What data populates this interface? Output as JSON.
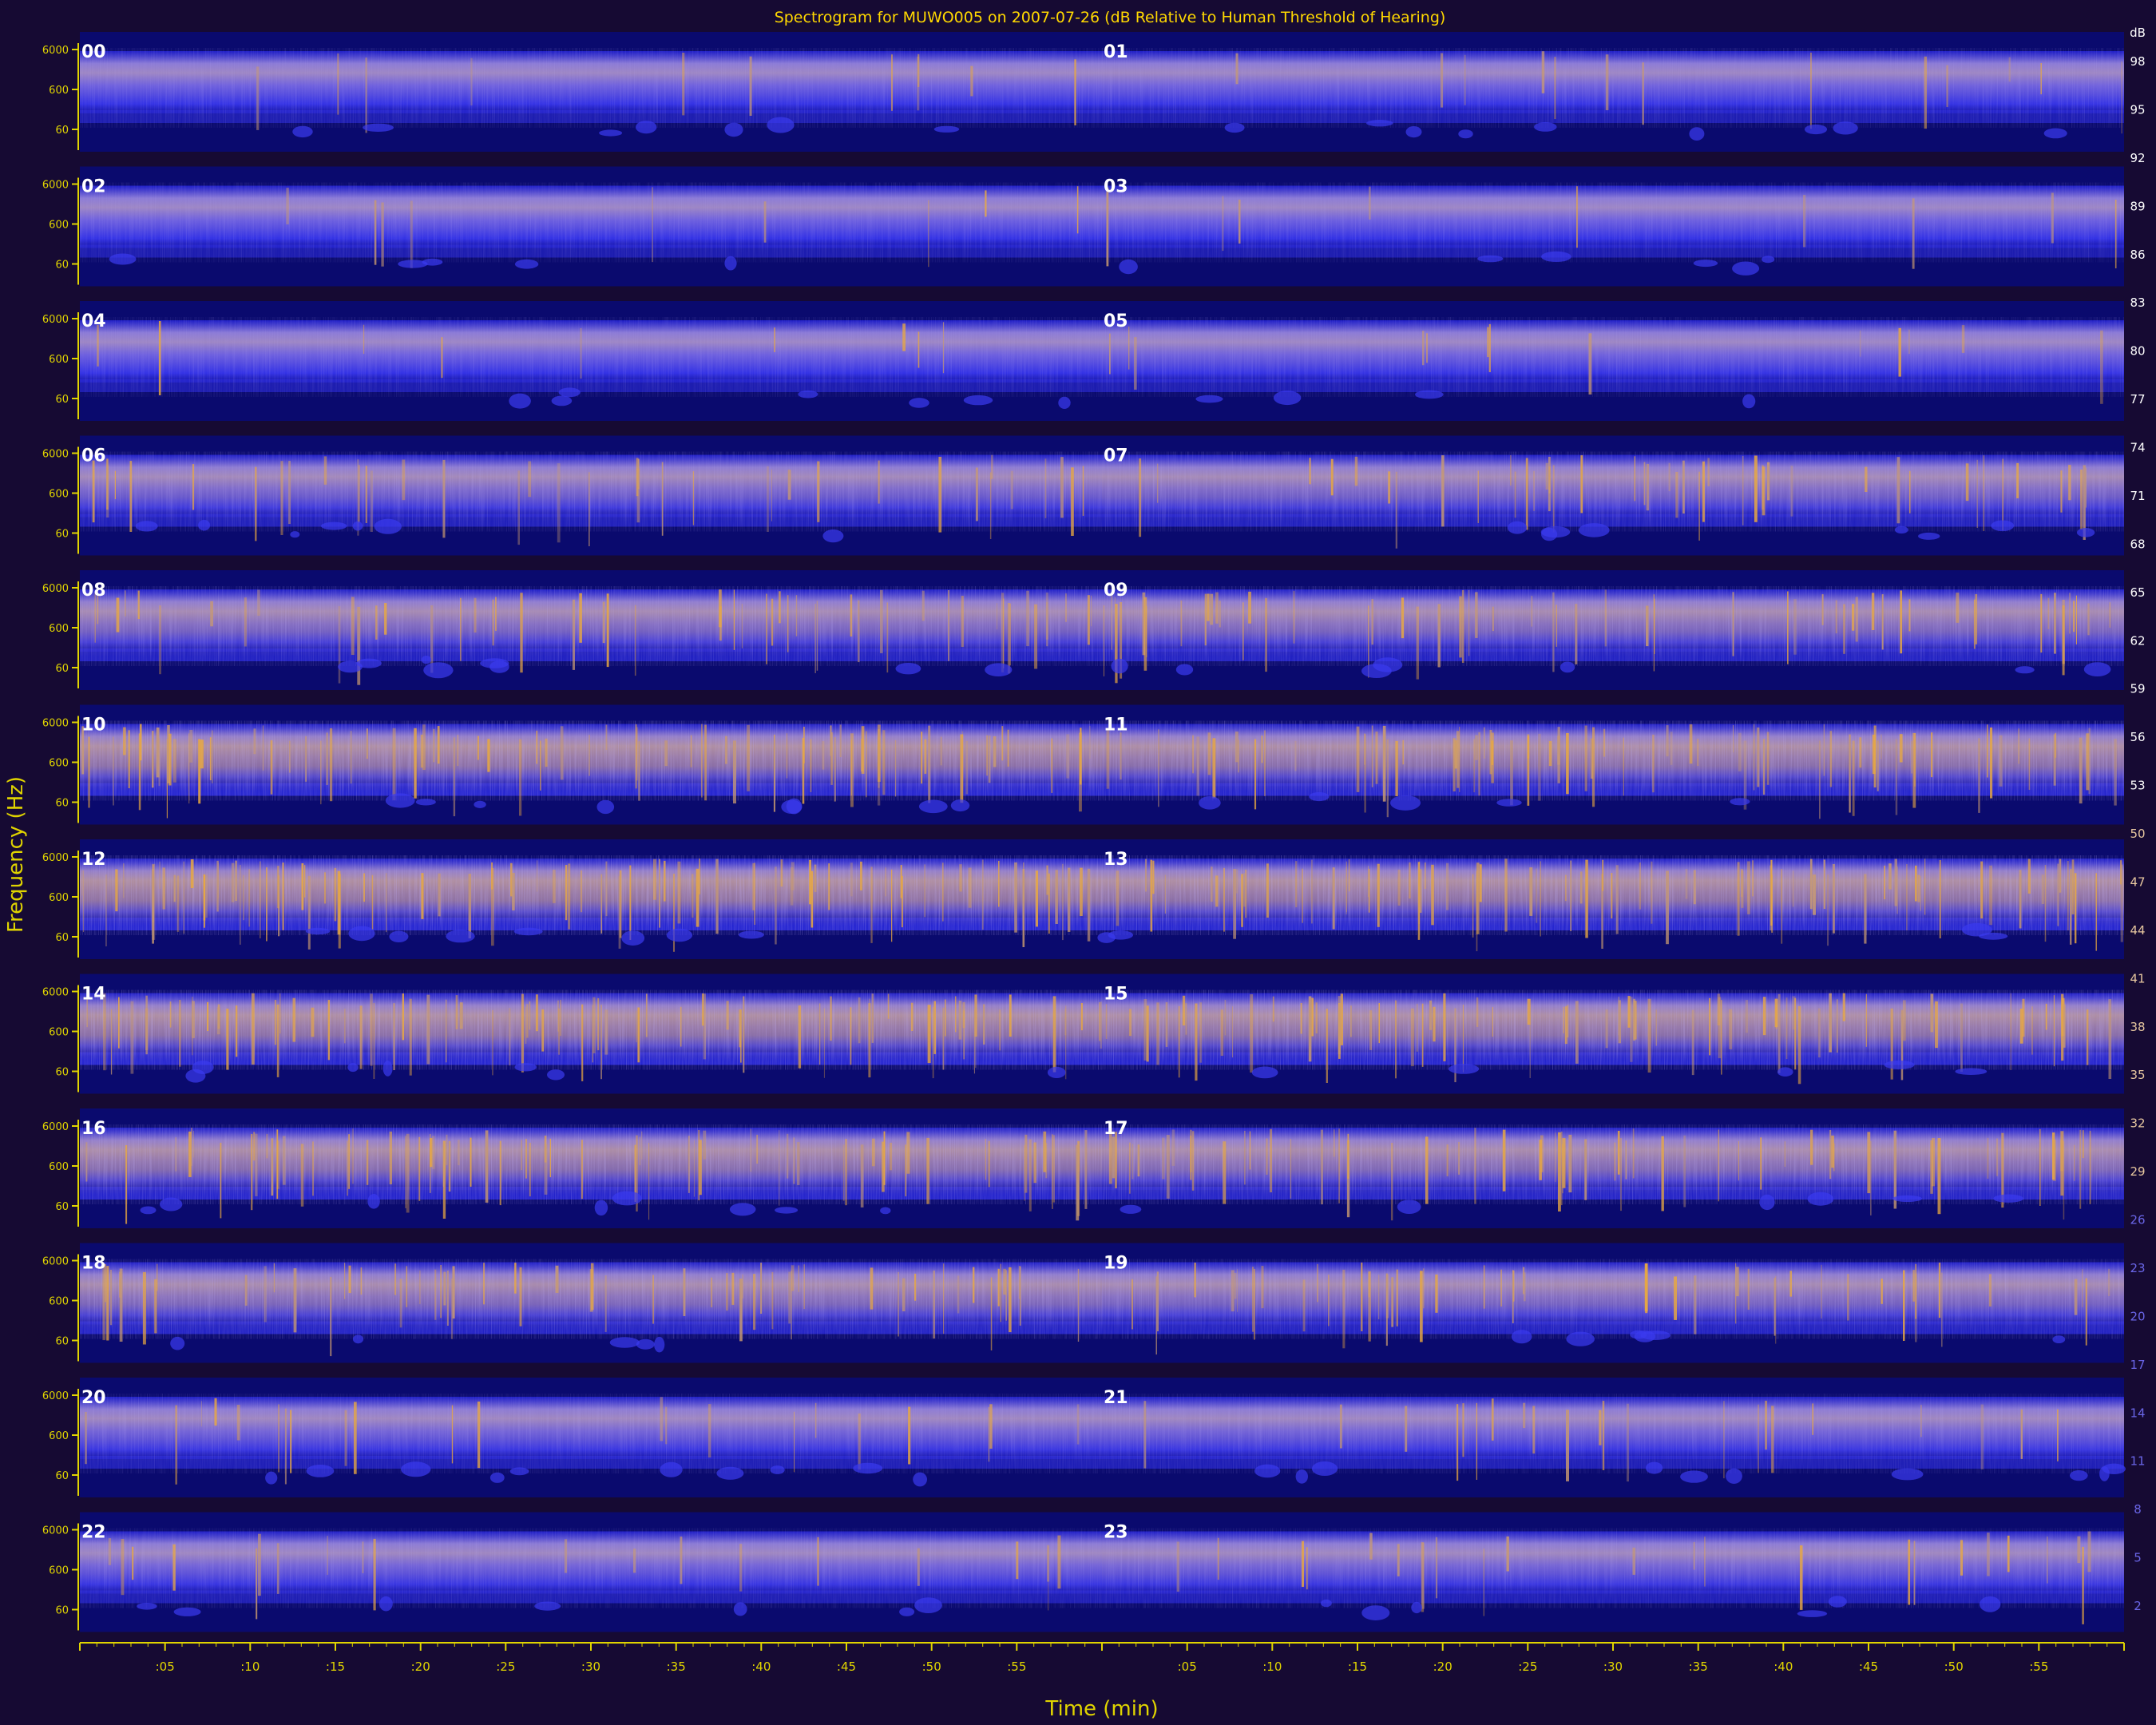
{
  "chart_data": {
    "type": "heatmap",
    "title": "Spectrogram for MUWO005 on 2007-07-26 (dB Relative to Human Threshold of Hearing)",
    "xlabel": "Time (min)",
    "ylabel": "Frequency (Hz)",
    "frequency_ticks": [
      "6000",
      "600",
      "60"
    ],
    "time_ticks": [
      ":05",
      ":10",
      ":15",
      ":20",
      ":25",
      ":30",
      ":35",
      ":40",
      ":45",
      ":50",
      ":55"
    ],
    "time_range_min": [
      0,
      60
    ],
    "panels_per_row": 2,
    "hour_labels": [
      "00",
      "01",
      "02",
      "03",
      "04",
      "05",
      "06",
      "07",
      "08",
      "09",
      "10",
      "11",
      "12",
      "13",
      "14",
      "15",
      "16",
      "17",
      "18",
      "19",
      "20",
      "21",
      "22",
      "23"
    ],
    "hour_intensity": [
      0.1,
      0.12,
      0.08,
      0.08,
      0.08,
      0.12,
      0.35,
      0.42,
      0.5,
      0.55,
      0.85,
      0.8,
      0.9,
      0.85,
      0.85,
      0.82,
      0.75,
      0.65,
      0.6,
      0.5,
      0.2,
      0.2,
      0.18,
      0.22
    ],
    "colorbar": {
      "label": "dB",
      "ticks": [
        "98",
        "95",
        "92",
        "89",
        "86",
        "83",
        "80",
        "77",
        "74",
        "71",
        "68",
        "65",
        "62",
        "59",
        "56",
        "53",
        "50",
        "47",
        "44",
        "41",
        "38",
        "35",
        "32",
        "29",
        "26",
        "23",
        "20",
        "17",
        "14",
        "11",
        "8",
        "5",
        "2"
      ],
      "range": [
        0,
        100
      ],
      "colors": [
        "#14106b",
        "#2323d9",
        "#4a46f0",
        "#8a78d8",
        "#c89a60",
        "#e8b040",
        "#f2d860"
      ]
    },
    "colors": {
      "background": "#160a33",
      "plot_background": "#0a0a6e",
      "axis": "#e0d400",
      "title_text": "#ffd800",
      "hour_label": "#ffffff"
    }
  }
}
